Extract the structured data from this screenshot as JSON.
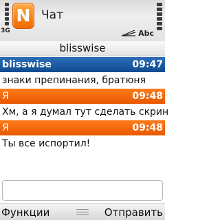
{
  "status": {
    "network": "3G",
    "input_mode": "Abc"
  },
  "app": {
    "title": "Чат",
    "icon_letter": "N"
  },
  "contact": {
    "name": "blisswise"
  },
  "messages": [
    {
      "sender": "blisswise",
      "time": "09:47",
      "text": "знаки препинания, братюня",
      "style": "peer"
    },
    {
      "sender": "Я",
      "time": "09:48",
      "text": "Хм, а я думал тут сделать скрин",
      "style": "me"
    },
    {
      "sender": "Я",
      "time": "09:48",
      "text": "Ты все испортил!",
      "style": "me"
    }
  ],
  "compose": {
    "value": ""
  },
  "softkeys": {
    "left": "Функции",
    "right": "Отправить"
  },
  "colors": {
    "peer_header": "#1a5aa0",
    "me_header": "#f26a10",
    "app_icon": "#f57f17"
  }
}
